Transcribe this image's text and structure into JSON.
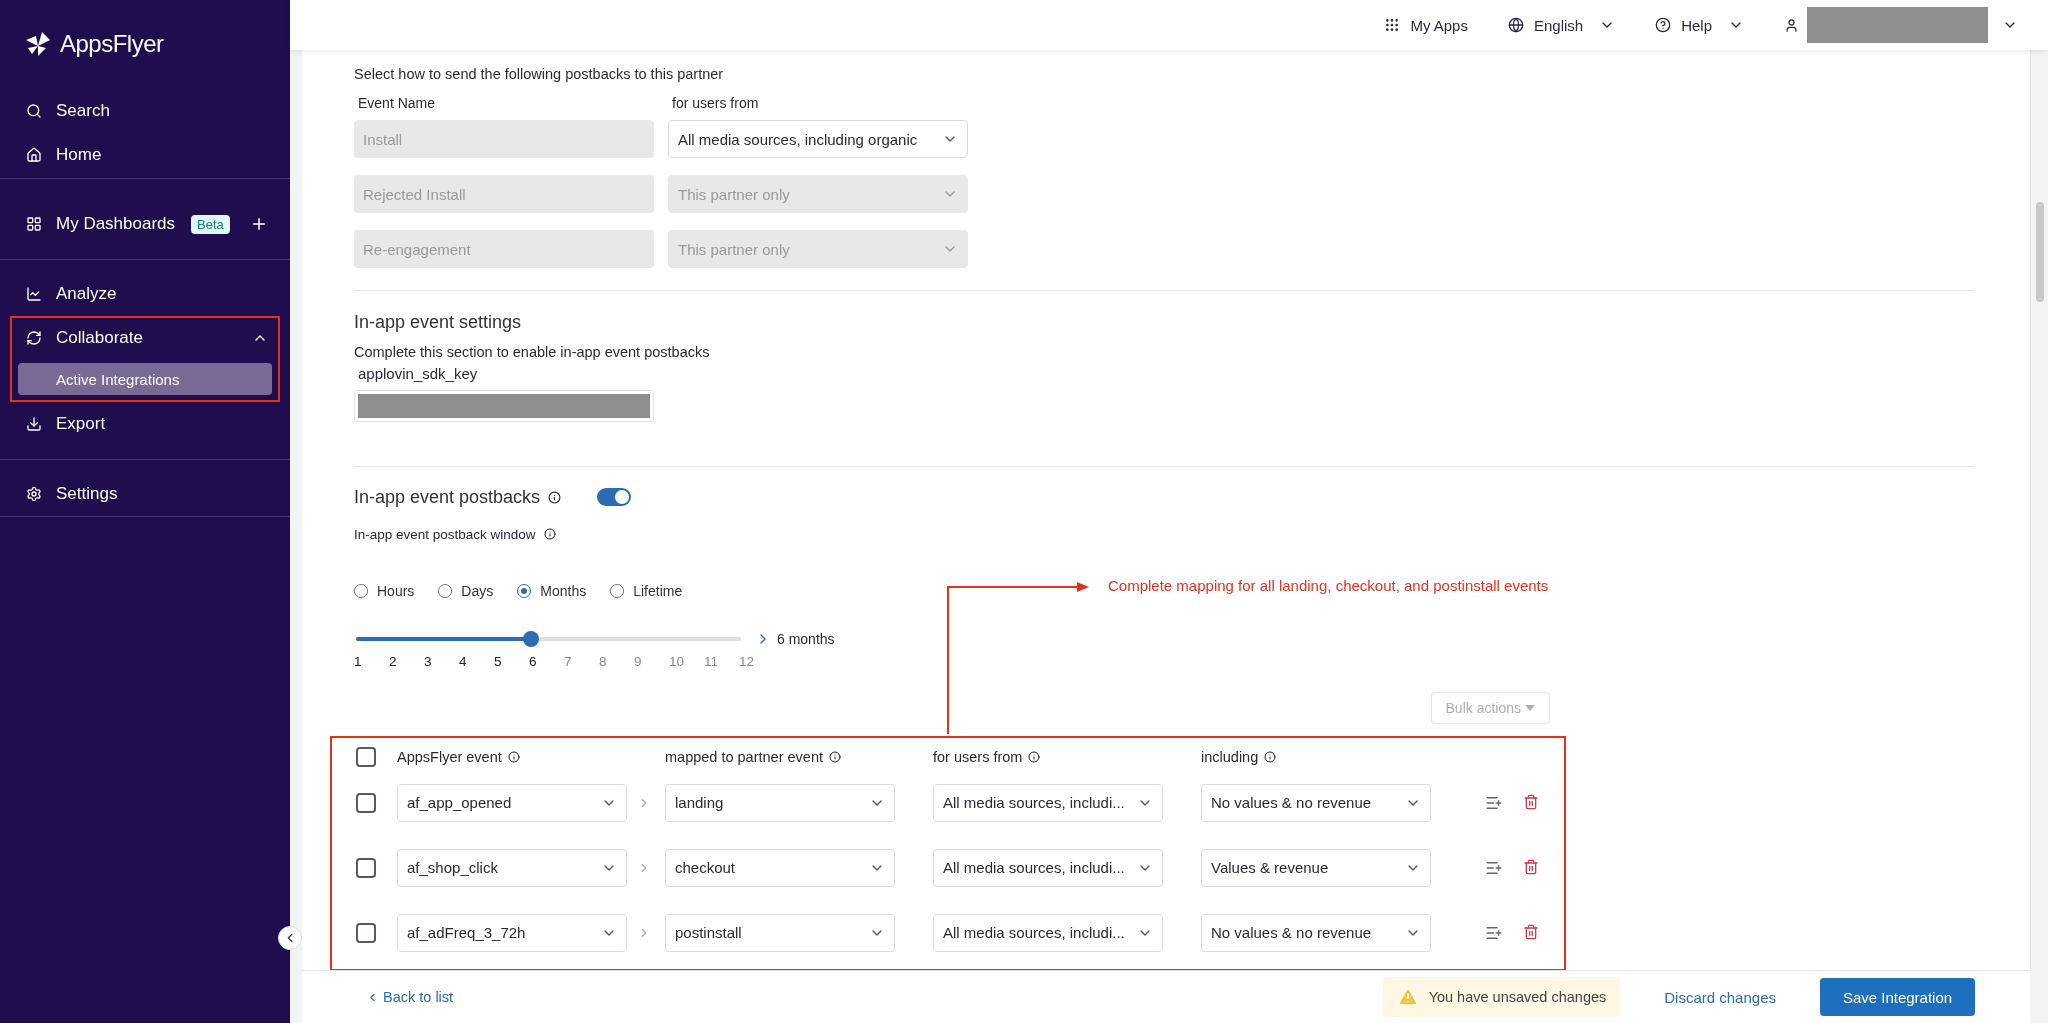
{
  "sidebar": {
    "logo": "AppsFlyer",
    "groups": [
      [
        {
          "label": "Search",
          "selected": false
        },
        {
          "label": "Home",
          "selected": false
        }
      ],
      [
        {
          "label": "My Dashboards",
          "selected": false,
          "badge": "Beta"
        }
      ],
      [
        {
          "label": "Analyze",
          "selected": false
        },
        {
          "label": "Collaborate",
          "selected": false,
          "expanded": true,
          "children": [
            {
              "label": "Active Integrations",
              "selected": true
            }
          ]
        },
        {
          "label": "Export",
          "selected": false
        }
      ],
      [
        {
          "label": "Settings",
          "selected": false
        }
      ]
    ]
  },
  "top_bar": {
    "items": [
      {
        "label": "My Apps",
        "dropdown": false
      },
      {
        "label": "English",
        "dropdown": true
      },
      {
        "label": "Help",
        "dropdown": true
      }
    ]
  },
  "default_postbacks": {
    "subtitle": "Select how to send the following postbacks to this partner",
    "columns": [
      "Event Name",
      "for users from"
    ],
    "rows": [
      {
        "event": "Install",
        "users": "All media sources, including organic",
        "disabled": false
      },
      {
        "event": "Rejected Install",
        "users": "This partner only",
        "disabled": true
      },
      {
        "event": "Re-engagement",
        "users": "This partner only",
        "disabled": true
      }
    ]
  },
  "in_app_settings": {
    "title": "In-app event settings",
    "subtitle": "Complete this section to enable in-app event postbacks",
    "field_label": "applovin_sdk_key"
  },
  "in_app_postbacks": {
    "label": "In-app event postbacks",
    "on": true,
    "window_label": "In-app event postback window",
    "radios": [
      {
        "label": "Hours",
        "selected": false
      },
      {
        "label": "Days",
        "selected": false
      },
      {
        "label": "Months",
        "selected": true
      },
      {
        "label": "Lifetime",
        "selected": false
      }
    ],
    "slider": {
      "level": 0.4545,
      "ticks": [
        "1",
        "2",
        "3",
        "4",
        "5",
        "6",
        "7",
        "8",
        "9",
        "10",
        "11",
        "12"
      ],
      "reading": "6 months"
    }
  },
  "annotation": "Complete mapping for all landing, checkout, and postinstall events",
  "bulk_actions": "Bulk actions",
  "mapping": {
    "checked": false,
    "columns": [
      "AppsFlyer event",
      "mapped to partner event",
      "for users from",
      "including"
    ],
    "rows": [
      {
        "checked": false,
        "event": "af_app_opened",
        "partner_event": "landing",
        "users": "All media sources, includi...",
        "including": "No values & no revenue"
      },
      {
        "checked": false,
        "event": "af_shop_click",
        "partner_event": "checkout",
        "users": "All media sources, includi...",
        "including": "Values & revenue"
      },
      {
        "checked": false,
        "event": "af_adFreq_3_72h",
        "partner_event": "postinstall",
        "users": "All media sources, includi...",
        "including": "No values & no revenue"
      }
    ]
  },
  "footer": {
    "back": "Back to list",
    "warning": "You have unsaved changes",
    "discard": "Discard changes",
    "save": "Save Integration"
  }
}
